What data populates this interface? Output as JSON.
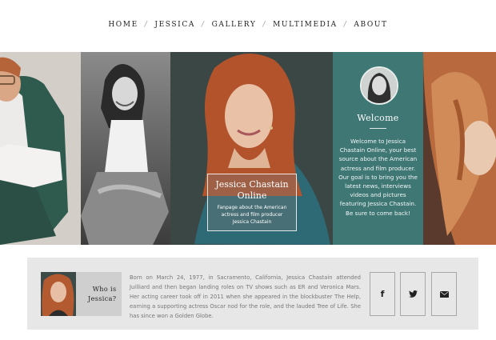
{
  "nav": {
    "items": [
      {
        "label": "HOME"
      },
      {
        "label": "JESSICA"
      },
      {
        "label": "GALLERY"
      },
      {
        "label": "MULTIMEDIA"
      },
      {
        "label": "ABOUT"
      }
    ],
    "separator": "/"
  },
  "welcome": {
    "title": "Welcome",
    "text": "Welcome to Jessica Chastain Online, your best source about the American actress and film producer. Our goal is to bring you the latest news, interviews videos and pictures featuring Jessica Chastain. Be sure to come back!"
  },
  "caption": {
    "title": "Jessica Chastain Online",
    "subtitle": "Fanpage about the American actress and film producer Jessica Chastain"
  },
  "bio": {
    "heading": "Who is Jessica?",
    "text": "Born on March 24, 1977, in Sacramento, California, Jessica Chastain attended Juilliard and then began landing roles on TV shows such as ER and Veronica Mars. Her acting career took off in 2011 when she appeared in the blockbuster The Help, earning a supporting actress Oscar nod for the role, and the lauded Tree of Life. She has since won a Golden Globe."
  },
  "social": {
    "facebook_glyph": "f",
    "icons": [
      "facebook-icon",
      "twitter-icon",
      "email-icon"
    ]
  },
  "colors": {
    "teal": "#3f7774",
    "bar": "#e7e7e7"
  }
}
